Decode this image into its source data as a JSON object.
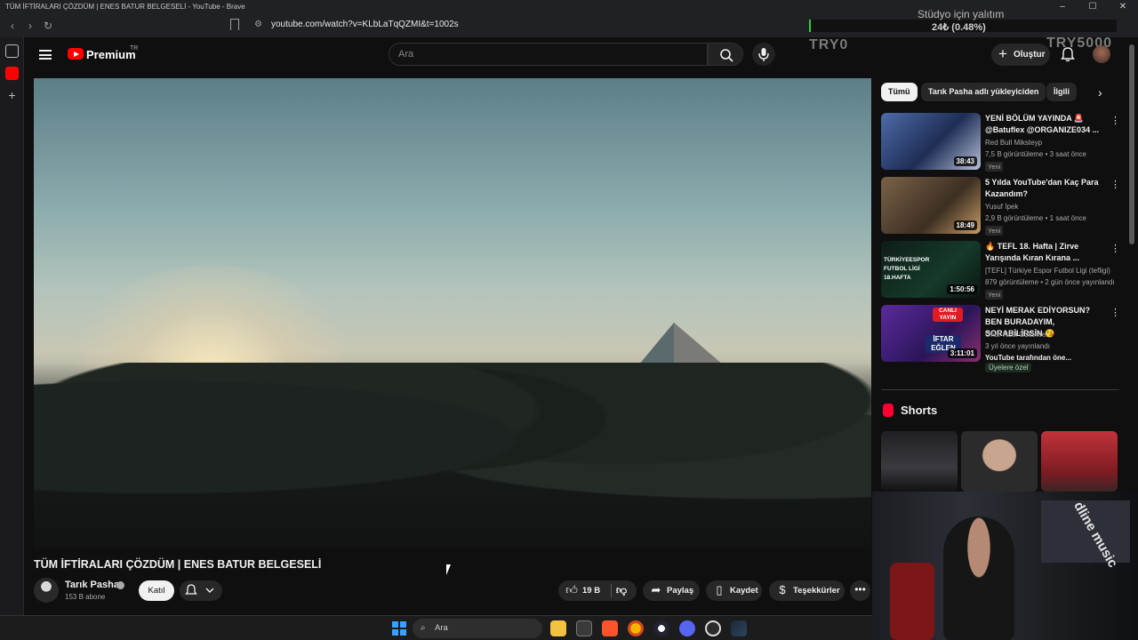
{
  "browser": {
    "window_title": "TÜM İFTİRALARI ÇÖZDÜM | ENES BATUR BELGESELİ - YouTube - Brave",
    "url": "youtube.com/watch?v=KLbLaTqQZMI&t=1002s"
  },
  "overlay": {
    "title": "Stüdyo için yalıtım",
    "progress_text": "24₺ (0.48%)",
    "progress": 0.0048,
    "left_label": "TRY0",
    "right_label": "TRY5000"
  },
  "header": {
    "brand": "Premium",
    "brand_region": "TR",
    "search_placeholder": "Ara",
    "create_label": "Oluştur"
  },
  "video": {
    "title": "TÜM İFTİRALARI ÇÖZDÜM | ENES BATUR BELGESELİ",
    "channel": "Tarık Pasha",
    "subscribers": "153 B abone",
    "join_label": "Katıl",
    "likes": "19 B",
    "share_label": "Paylaş",
    "save_label": "Kaydet",
    "thanks_label": "Teşekkürler"
  },
  "chips": [
    "Tümü",
    "Tarık Pasha adlı yükleyiciden",
    "İlgili"
  ],
  "recommendations": [
    {
      "title": "YENİ BÖLÜM YAYINDA 🚨 @Batuflex @ORGANIZE034 ...",
      "channel": "Red Bull Miksteyp",
      "meta": "7,5 B görüntüleme • 3 saat önce",
      "badge": "Yeni",
      "duration": "38:43"
    },
    {
      "title": "5 Yılda YouTube'dan Kaç Para Kazandım?",
      "channel": "Yusuf İpek",
      "meta": "2,9 B görüntüleme • 1 saat önce",
      "badge": "Yeni",
      "duration": "18:49"
    },
    {
      "title": "🔥 TEFL 18. Hafta | Zirve Yarışında Kıran Kırana ...",
      "channel": "[TEFL] Türkiye Espor Futbol Ligi (tefligi)",
      "meta": "879 görüntüleme • 2 gün önce yayınlandı",
      "badge": "Yeni",
      "duration": "1:50:56"
    },
    {
      "title": "NEYİ MERAK EDİYORSUN? BEN BURADAYIM, SORABİLİRSİN 😘",
      "channel": "Onur Naci Öztürkler",
      "meta": "3 yıl önce yayınlandı",
      "badge": "YouTube tarafından öne...",
      "members": "Üyelere özel",
      "duration": "3:11:01"
    }
  ],
  "shorts": {
    "title": "Shorts"
  },
  "thumb_texts": {
    "tefl": "TÜRKİYEESPOR FUTBOL LİGİ 18.HAFTA",
    "live": "CANLI YAYIN",
    "iftar": "İFTAR EĞLEN"
  },
  "webcam_text": "dline music",
  "taskbar": {
    "search_label": "Ara"
  }
}
